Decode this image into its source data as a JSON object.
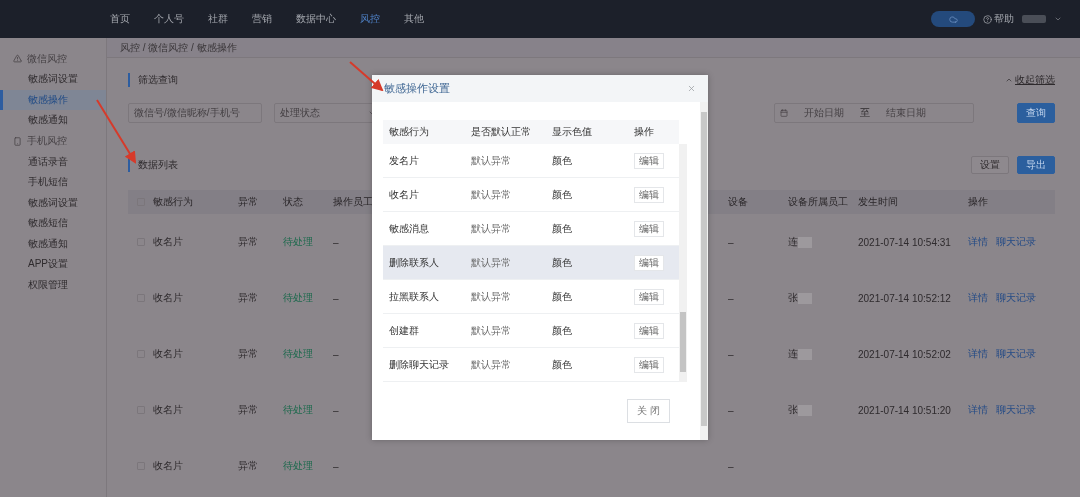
{
  "nav": {
    "items": [
      {
        "label": "首页",
        "selected": false
      },
      {
        "label": "个人号",
        "selected": false
      },
      {
        "label": "社群",
        "selected": false
      },
      {
        "label": "营销",
        "selected": false
      },
      {
        "label": "数据中心",
        "selected": false
      },
      {
        "label": "风控",
        "selected": true
      },
      {
        "label": "其他",
        "selected": false
      }
    ],
    "help": "帮助"
  },
  "sidebar": {
    "groups": [
      {
        "title": "微信风控",
        "kind": "alert",
        "items": [
          {
            "label": "敏感词设置",
            "selected": false
          },
          {
            "label": "敏感操作",
            "selected": true
          },
          {
            "label": "敏感通知",
            "selected": false
          }
        ]
      },
      {
        "title": "手机风控",
        "kind": "phone",
        "items": [
          {
            "label": "通话录音",
            "selected": false
          },
          {
            "label": "手机短信",
            "selected": false
          },
          {
            "label": "敏感词设置",
            "selected": false
          },
          {
            "label": "敏感短信",
            "selected": false
          },
          {
            "label": "敏感通知",
            "selected": false
          },
          {
            "label": "APP设置",
            "selected": false
          },
          {
            "label": "权限管理",
            "selected": false
          }
        ]
      }
    ]
  },
  "breadcrumb": "风控 / 微信风控 / 敏感操作",
  "filter": {
    "title": "筛选查询",
    "collapse": "收起筛选",
    "search_placeholder": "微信号/微信昵称/手机号",
    "status_placeholder": "处理状态",
    "date_start_placeholder": "开始日期",
    "date_sep": "至",
    "date_end_placeholder": "结束日期",
    "query_button": "查询"
  },
  "list": {
    "title": "数据列表",
    "settings_button": "设置",
    "export_button": "导出",
    "all_checked": false,
    "columns": {
      "behavior": "敏感行为",
      "abnormal": "异常",
      "status": "状态",
      "operator": "操作员工",
      "device": "设备",
      "owner": "设备所属员工",
      "time": "发生时间",
      "action": "操作"
    },
    "rows": [
      {
        "checked": false,
        "behavior": "收名片",
        "abnormal": "异常",
        "status": "待处理",
        "operator": "–",
        "device": "–",
        "owner": "连",
        "time": "2021-07-14 10:54:31",
        "actions": [
          "详情",
          "聊天记录"
        ]
      },
      {
        "checked": false,
        "behavior": "收名片",
        "abnormal": "异常",
        "status": "待处理",
        "operator": "–",
        "device": "–",
        "owner": "张",
        "time": "2021-07-14 10:52:12",
        "actions": [
          "详情",
          "聊天记录"
        ]
      },
      {
        "checked": false,
        "behavior": "收名片",
        "abnormal": "异常",
        "status": "待处理",
        "operator": "–",
        "device": "–",
        "owner": "连",
        "time": "2021-07-14 10:52:02",
        "actions": [
          "详情",
          "聊天记录"
        ]
      },
      {
        "checked": false,
        "behavior": "收名片",
        "abnormal": "异常",
        "status": "待处理",
        "operator": "–",
        "device": "–",
        "owner": "张",
        "time": "2021-07-14 10:51:20",
        "actions": [
          "详情",
          "聊天记录"
        ]
      },
      {
        "checked": false,
        "behavior": "收名片",
        "abnormal": "异常",
        "status": "待处理",
        "operator": "–",
        "device": "–",
        "owner": "",
        "time": "",
        "actions": []
      }
    ]
  },
  "modal": {
    "title": "敏感操作设置",
    "columns": [
      "敏感行为",
      "是否默认正常",
      "显示色值",
      "操作"
    ],
    "rows": [
      {
        "behavior": "发名片",
        "default": "默认异常",
        "color_value": "颜色",
        "action": "编辑",
        "highlighted": false
      },
      {
        "behavior": "收名片",
        "default": "默认异常",
        "color_value": "颜色",
        "action": "编辑",
        "highlighted": false
      },
      {
        "behavior": "敏感消息",
        "default": "默认异常",
        "color_value": "颜色",
        "action": "编辑",
        "highlighted": false
      },
      {
        "behavior": "删除联系人",
        "default": "默认异常",
        "color_value": "颜色",
        "action": "编辑",
        "highlighted": true
      },
      {
        "behavior": "拉黑联系人",
        "default": "默认异常",
        "color_value": "颜色",
        "action": "编辑",
        "highlighted": false
      },
      {
        "behavior": "创建群",
        "default": "默认异常",
        "color_value": "颜色",
        "action": "编辑",
        "highlighted": false
      },
      {
        "behavior": "删除聊天记录",
        "default": "默认异常",
        "color_value": "颜色",
        "action": "编辑",
        "highlighted": false
      }
    ],
    "close_button": "关 闭"
  }
}
